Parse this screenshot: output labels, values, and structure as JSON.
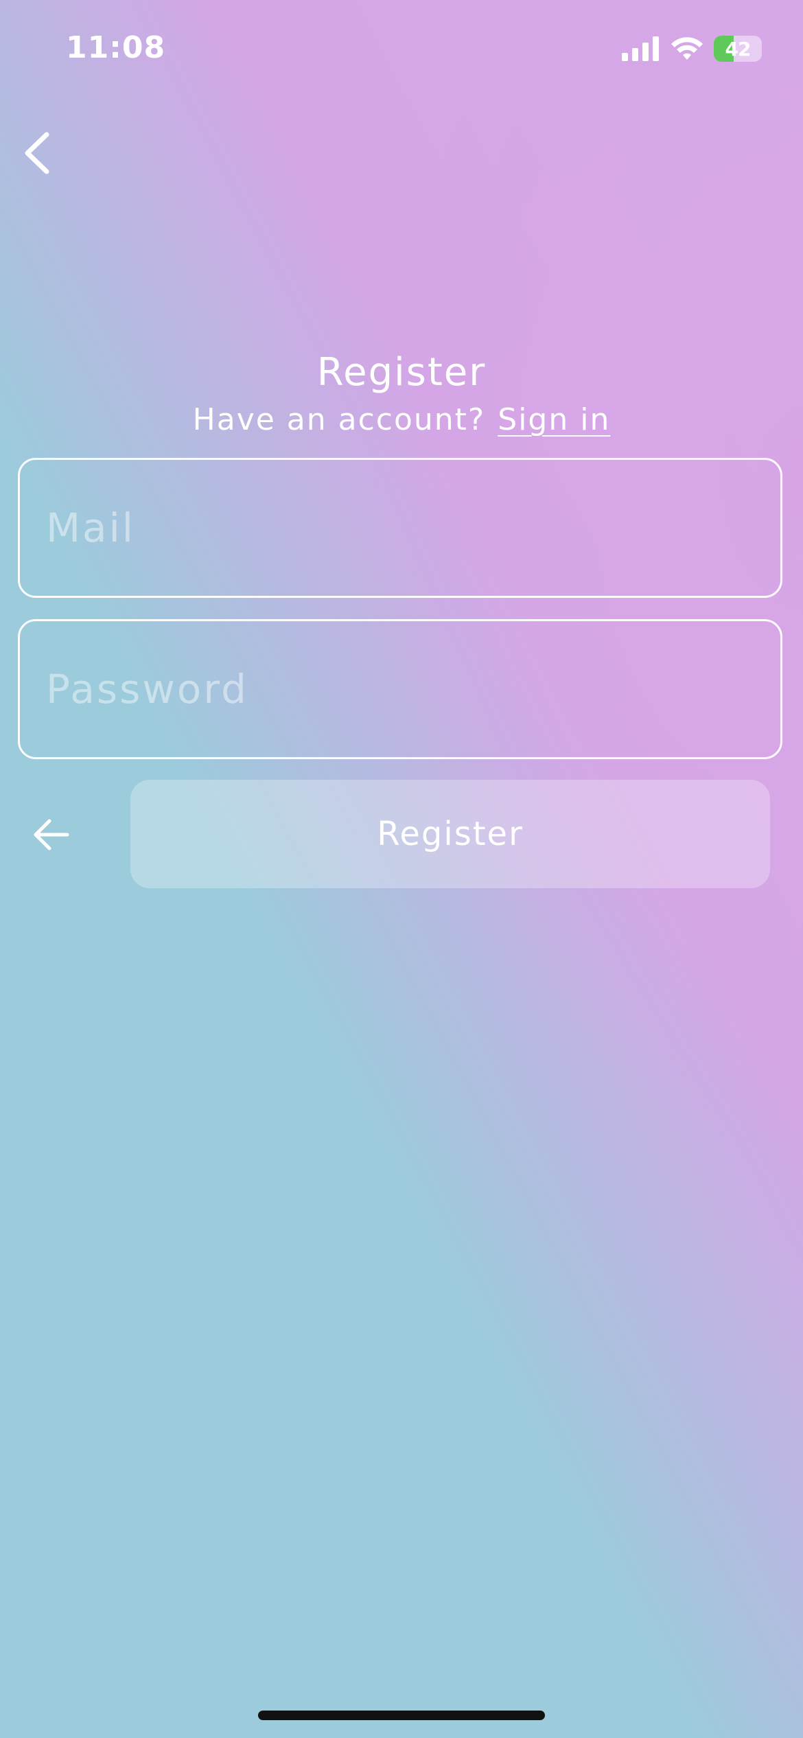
{
  "status_bar": {
    "time": "11:08",
    "battery_text": "42",
    "battery_level_percent": 42
  },
  "header": {
    "title": "Register",
    "subtitle": "Have an account?",
    "sign_in_link": "Sign in"
  },
  "form": {
    "mail_placeholder": "Mail",
    "password_placeholder": "Password",
    "register_button_label": "Register"
  },
  "icons": {
    "top_back": "chevron-left-icon",
    "bottom_back": "arrow-left-icon",
    "signal": "cellular-signal-icon",
    "wifi": "wifi-icon",
    "battery": "battery-icon"
  },
  "colors": {
    "gradient_blue": "#9ccbdc",
    "gradient_pink": "#d7a9e7",
    "battery_green": "#5fca5a"
  }
}
